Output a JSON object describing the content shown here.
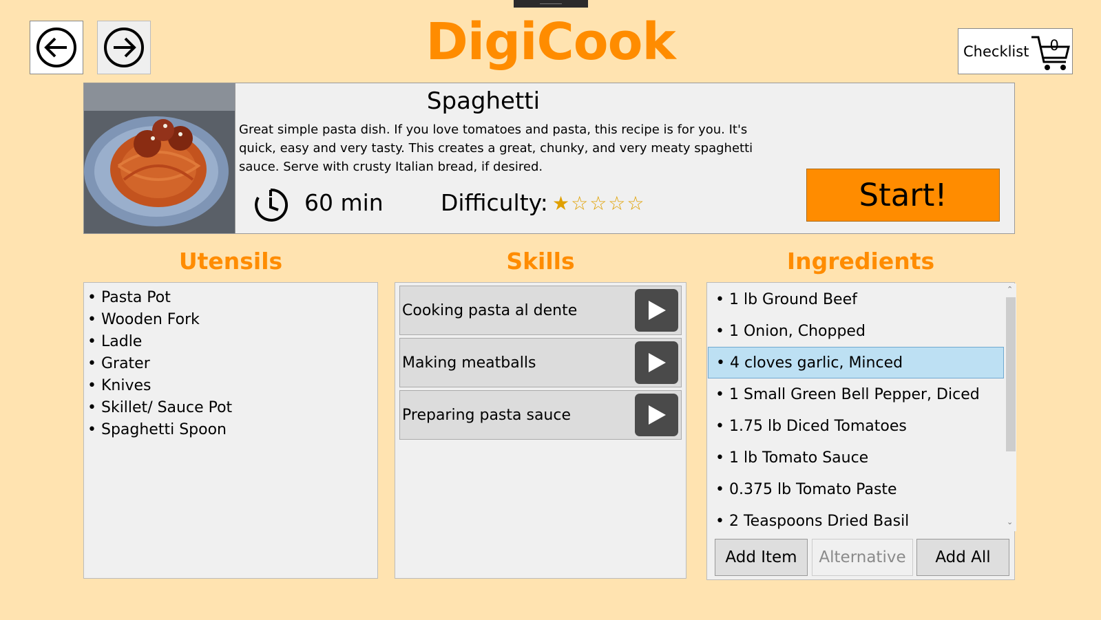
{
  "app": {
    "title": "DigiCook",
    "brand_color": "#ff8c00",
    "background": "#ffe3b0"
  },
  "nav": {
    "back_icon": "arrow-left-circle-icon",
    "forward_icon": "arrow-right-circle-icon"
  },
  "checklist": {
    "label": "Checklist",
    "count": "0",
    "icon": "cart-icon"
  },
  "recipe": {
    "name": "Spaghetti",
    "description": "Great simple pasta dish. If you love tomatoes and pasta, this recipe is for you. It's quick, easy and very tasty. This creates a great, chunky, and very meaty spaghetti sauce. Serve with crusty Italian bread, if desired.",
    "time": "60 min",
    "difficulty_label": "Difficulty:",
    "difficulty_stars": "★☆☆☆☆",
    "difficulty_rating": 1,
    "difficulty_max": 5,
    "start_label": "Start!"
  },
  "utensils": {
    "heading": "Utensils",
    "items": [
      "Pasta Pot",
      "Wooden Fork",
      "Ladle",
      "Grater",
      "Knives",
      "Skillet/ Sauce Pot",
      "Spaghetti Spoon"
    ]
  },
  "skills": {
    "heading": "Skills",
    "items": [
      "Cooking pasta al dente",
      "Making meatballs",
      "Preparing pasta sauce"
    ]
  },
  "ingredients": {
    "heading": "Ingredients",
    "items": [
      "1 lb Ground Beef",
      "1 Onion, Chopped",
      "4 cloves garlic, Minced",
      "1 Small Green Bell Pepper, Diced",
      "1.75 lb Diced Tomatoes",
      "1 lb Tomato Sauce",
      "0.375 lb Tomato Paste",
      "2 Teaspoons Dried Basil"
    ],
    "selected": "4 cloves garlic, Minced",
    "add_item_label": "Add Item",
    "alternative_label": "Alternative",
    "add_all_label": "Add All"
  }
}
